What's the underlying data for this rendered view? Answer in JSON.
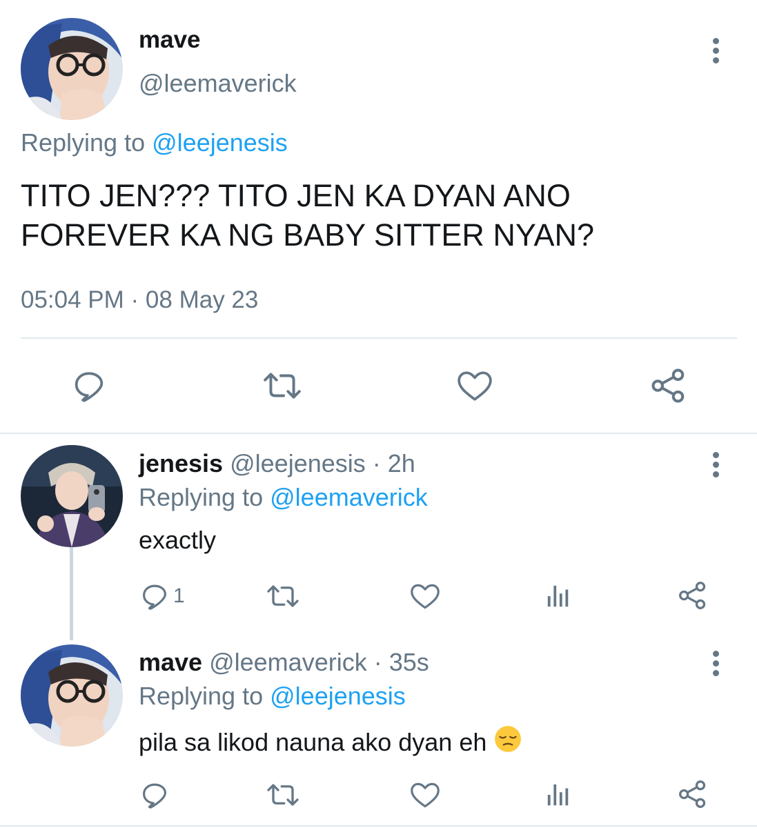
{
  "main_tweet": {
    "name": "mave",
    "handle": "@leemaverick",
    "replying_prefix": "Replying to",
    "replying_handle": "@leejenesis",
    "text": "TITO JEN??? TITO JEN KA DYAN ANO FOREVER KA NG BABY SITTER NYAN?",
    "timestamp": "05:04 PM · 08 May 23",
    "actions": [
      "reply-icon",
      "retweet-icon",
      "like-icon",
      "share-icon"
    ]
  },
  "replies": [
    {
      "name": "jenesis",
      "handle": "@leejenesis",
      "time": "· 2h",
      "replying_prefix": "Replying to",
      "replying_handle": "@leemaverick",
      "text": "exactly",
      "reply_count": "1",
      "actions": [
        "reply-icon",
        "retweet-icon",
        "like-icon",
        "analytics-icon",
        "share-icon"
      ]
    },
    {
      "name": "mave",
      "handle": "@leemaverick",
      "time": "· 35s",
      "replying_prefix": "Replying to",
      "replying_handle": "@leejenesis",
      "text": "pila sa likod nauna ako dyan eh",
      "emoji": "pensive-face-emoji",
      "actions": [
        "reply-icon",
        "retweet-icon",
        "like-icon",
        "analytics-icon",
        "share-icon"
      ]
    }
  ],
  "colors": {
    "link": "#1da1f2",
    "secondary_text": "#657786",
    "icon": "#657786",
    "divider": "#e1e8ed"
  }
}
